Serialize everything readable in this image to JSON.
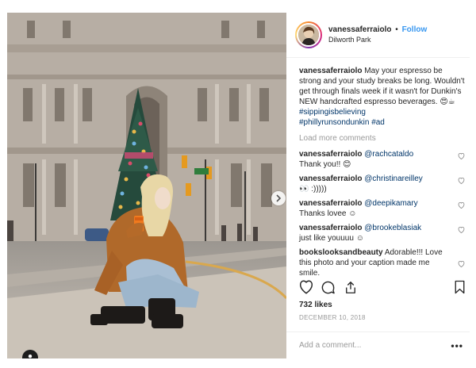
{
  "post_header": {
    "username": "vanessaferraiolo",
    "separator": "•",
    "follow_label": "Follow",
    "location": "Dilworth Park"
  },
  "caption": {
    "username": "vanessaferraiolo",
    "text": "May your espresso be strong and your study breaks be long. Wouldn't get through finals week if it wasn't for Dunkin's NEW handcrafted espresso beverages. 😍☕",
    "hashtags": [
      "#sippingisbelieving",
      "#phillyrunsondunkin",
      "#ad"
    ]
  },
  "load_more_label": "Load more comments",
  "comments": [
    {
      "username": "vanessaferraiolo",
      "mention": "@rachcataldo",
      "text": "Thank you!! 😊"
    },
    {
      "username": "vanessaferraiolo",
      "mention": "@christinareilley",
      "text": "👀 :)))))"
    },
    {
      "username": "vanessaferraiolo",
      "mention": "@deepikamary",
      "text": "Thanks lovee ☺"
    },
    {
      "username": "vanessaferraiolo",
      "mention": "@brookeblasiak",
      "text": "just like youuuu ☺"
    },
    {
      "username": "bookslooksandbeauty",
      "mention": "",
      "text": "Adorable!!! Love this photo and your caption made me smile."
    }
  ],
  "likes_label": "732 likes",
  "date_label": "DECEMBER 10, 2018",
  "add_comment_placeholder": "Add a comment...",
  "more_options": "•••",
  "icons": {
    "like": "heart-icon",
    "comment": "comment-icon",
    "share": "share-icon",
    "save": "bookmark-icon",
    "next": "chevron-right-icon",
    "tag": "user-tag-icon"
  },
  "colors": {
    "link_blue": "#3897f0",
    "hashtag": "#003569",
    "muted": "#999999",
    "text": "#262626",
    "divider": "#efefef"
  },
  "carousel": {
    "count": 2,
    "active": 1
  }
}
